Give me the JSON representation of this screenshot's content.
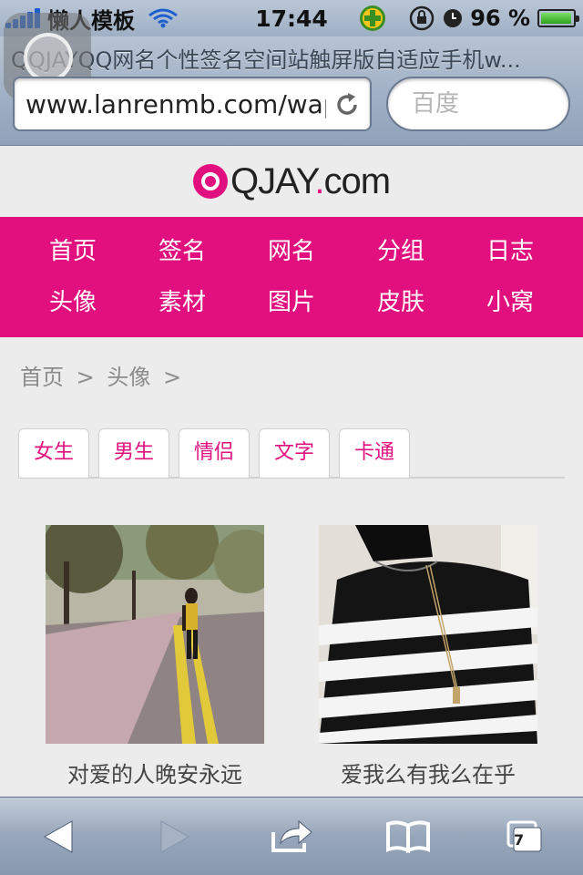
{
  "status_bar": {
    "carrier": "懒人模板",
    "time": "17:44",
    "battery": "96 %",
    "battery_level": 0.96
  },
  "browser": {
    "page_title": "QQJAYQQ网名个性签名空间站触屏版自适应手机w...",
    "url": "www.lanrenmb.com/wap",
    "search_placeholder": "百度"
  },
  "site": {
    "logo_text": "QJAY",
    "logo_suffix": ".com",
    "brand_color": "#e2107e",
    "nav": [
      "首页",
      "签名",
      "网名",
      "分组",
      "日志",
      "头像",
      "素材",
      "图片",
      "皮肤",
      "小窝"
    ],
    "breadcrumb": [
      "首页",
      ">",
      "头像",
      ">"
    ],
    "tabs": [
      "女生",
      "男生",
      "情侣",
      "文字",
      "卡通"
    ],
    "items": [
      {
        "caption": "对爱的人晚安永远",
        "image": "girl-walking-on-road-photo"
      },
      {
        "caption": "爱我么有我么在乎",
        "image": "striped-sweater-photo"
      }
    ]
  },
  "toolbar": {
    "tabs_count": "7",
    "icons": [
      "back-icon",
      "forward-icon",
      "share-icon",
      "bookmarks-icon",
      "tabs-icon"
    ]
  }
}
